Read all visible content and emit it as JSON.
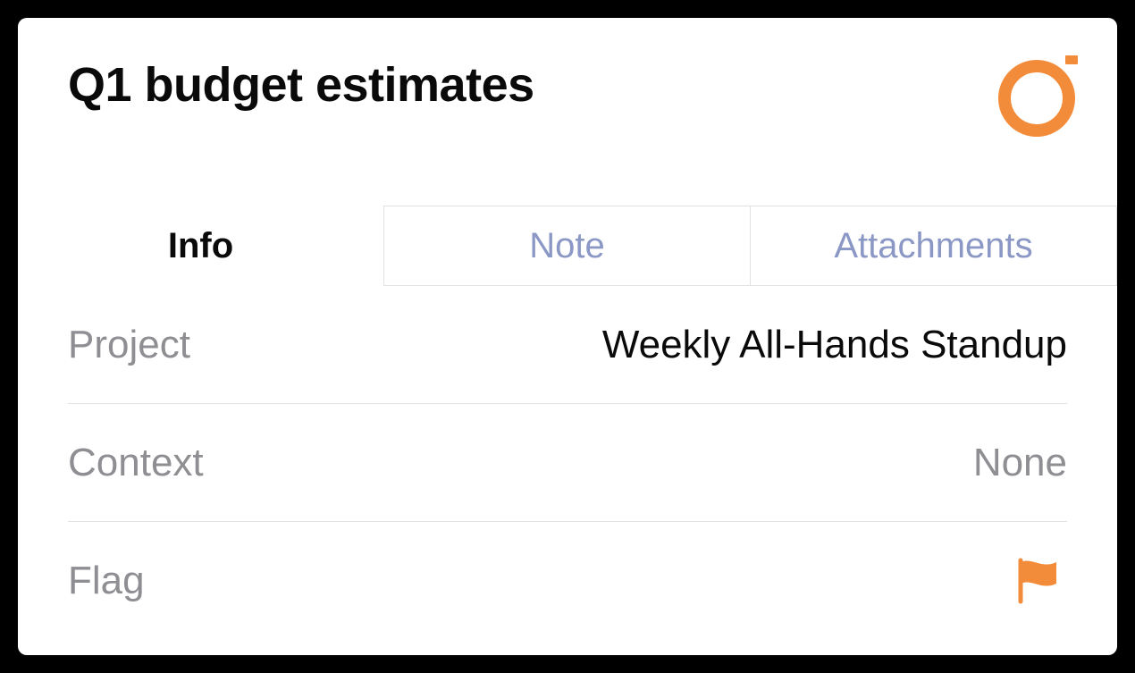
{
  "title": "Q1 budget estimates",
  "colors": {
    "accent": "#f28c3a"
  },
  "tabs": {
    "info": "Info",
    "note": "Note",
    "attachments": "Attachments",
    "active": "info"
  },
  "info": {
    "project": {
      "label": "Project",
      "value": "Weekly All-Hands Standup"
    },
    "context": {
      "label": "Context",
      "value": "None"
    },
    "flag": {
      "label": "Flag",
      "flagged": true
    }
  }
}
